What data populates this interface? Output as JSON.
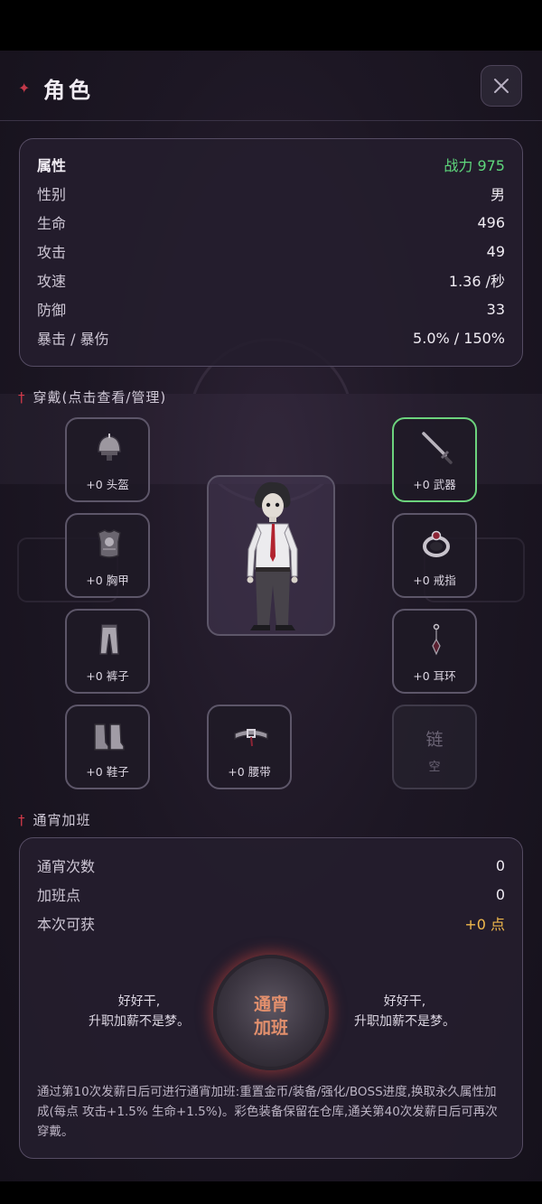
{
  "header": {
    "title": "角色"
  },
  "stats": {
    "heading": "属性",
    "power": "战力 975",
    "rows": [
      {
        "label": "性别",
        "value": "男"
      },
      {
        "label": "生命",
        "value": "496"
      },
      {
        "label": "攻击",
        "value": "49"
      },
      {
        "label": "攻速",
        "value": "1.36 /秒"
      },
      {
        "label": "防御",
        "value": "33"
      },
      {
        "label": "暴击 / 暴伤",
        "value": "5.0% / 150%"
      }
    ]
  },
  "equipment": {
    "title": "穿戴(点击查看/管理)",
    "slots": {
      "helmet": "+0 头盔",
      "weapon": "+0 武器",
      "chest": "+0 胸甲",
      "ring": "+0 戒指",
      "pants": "+0 裤子",
      "earring": "+0 耳环",
      "shoes": "+0 鞋子",
      "belt": "+0 腰带",
      "chain_name": "链",
      "chain_status": "空"
    }
  },
  "overtime": {
    "title": "通宵加班",
    "rows": [
      {
        "label": "通宵次数",
        "value": "0"
      },
      {
        "label": "加班点",
        "value": "0"
      },
      {
        "label": "本次可获",
        "value": "+0 点"
      }
    ],
    "flavor_line1": "好好干,",
    "flavor_line2": "升职加薪不是梦。",
    "button_line1": "通宵",
    "button_line2": "加班",
    "note": "通过第10次发薪日后可进行通宵加班:重置金币/装备/强化/BOSS进度,换取永久属性加成(每点 攻击+1.5% 生命+1.5%)。彩色装备保留在仓库,通关第40次发薪日后可再次穿戴。"
  },
  "colors": {
    "accent_green": "#5ed77c",
    "gold": "#f1b94c",
    "danger_red": "#d33a4a"
  }
}
